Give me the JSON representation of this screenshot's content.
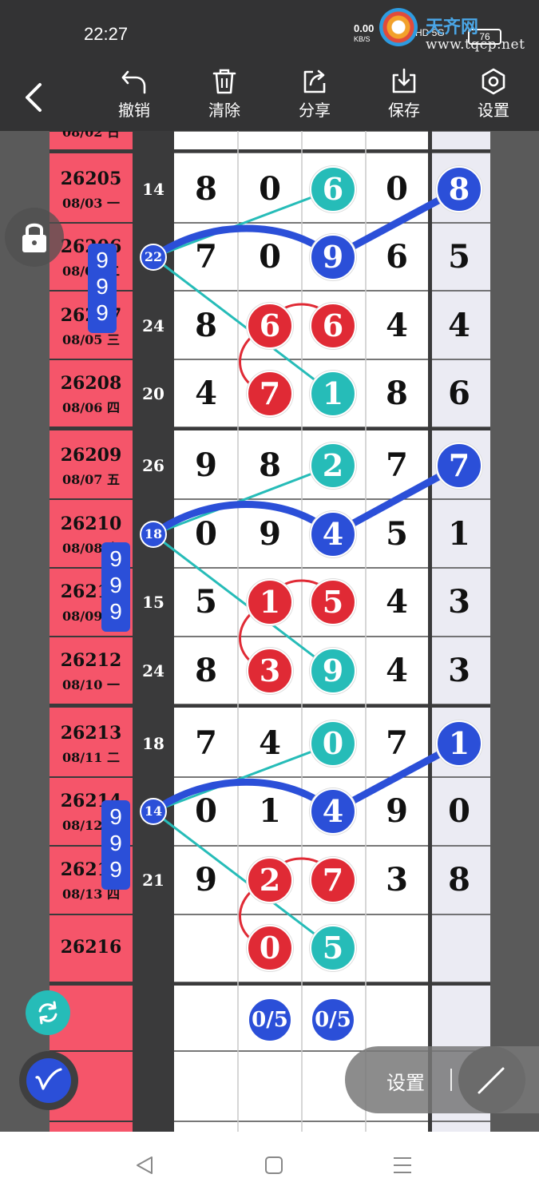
{
  "status_bar": {
    "time": "22:27",
    "net_speed_value": "0.00",
    "net_speed_unit": "KB/S",
    "signal_text": "HD 5G",
    "battery": "76"
  },
  "watermark": {
    "site": "www.tqcp.net",
    "brand": "天齐网"
  },
  "toolbar": {
    "back_icon": "chevron-left-icon",
    "items": [
      {
        "label": "撤销",
        "icon": "undo-icon"
      },
      {
        "label": "清除",
        "icon": "trash-icon"
      },
      {
        "label": "分享",
        "icon": "share-icon"
      },
      {
        "label": "保存",
        "icon": "download-icon"
      },
      {
        "label": "设置",
        "icon": "settings-hex-icon"
      }
    ]
  },
  "periods": [
    {
      "id": "26205",
      "date": "08/03 一",
      "sum": "14",
      "digits": [
        "8",
        "0",
        "6",
        "0",
        "8"
      ]
    },
    {
      "id": "26206",
      "date": "08/04 二",
      "sum": "22",
      "digits": [
        "7",
        "0",
        "9",
        "6",
        "5"
      ]
    },
    {
      "id": "26207",
      "date": "08/05 三",
      "sum": "24",
      "digits": [
        "8",
        "6",
        "6",
        "4",
        "4"
      ]
    },
    {
      "id": "26208",
      "date": "08/06 四",
      "sum": "20",
      "digits": [
        "4",
        "7",
        "1",
        "8",
        "6"
      ]
    },
    {
      "id": "26209",
      "date": "08/07 五",
      "sum": "26",
      "digits": [
        "9",
        "8",
        "2",
        "7",
        "7"
      ]
    },
    {
      "id": "26210",
      "date": "08/08 六",
      "sum": "18",
      "digits": [
        "0",
        "9",
        "4",
        "5",
        "1"
      ]
    },
    {
      "id": "26211",
      "date": "08/09 日",
      "sum": "15",
      "digits": [
        "5",
        "1",
        "5",
        "4",
        "3"
      ]
    },
    {
      "id": "26212",
      "date": "08/10 一",
      "sum": "24",
      "digits": [
        "8",
        "3",
        "9",
        "4",
        "3"
      ]
    },
    {
      "id": "26213",
      "date": "08/11 二",
      "sum": "18",
      "digits": [
        "7",
        "4",
        "0",
        "7",
        "1"
      ]
    },
    {
      "id": "26214",
      "date": "08/12 三",
      "sum": "14",
      "digits": [
        "0",
        "1",
        "4",
        "9",
        "0"
      ]
    },
    {
      "id": "26215",
      "date": "08/13 四",
      "sum": "21",
      "digits": [
        "9",
        "2",
        "7",
        "3",
        "8"
      ]
    },
    {
      "id": "26216",
      "date": "",
      "sum": "",
      "digits": [
        "",
        "0",
        "5",
        "",
        ""
      ]
    }
  ],
  "cut_top_date": "08/02 日",
  "tag_999": "999",
  "ratio_labels": [
    "0/5",
    "0/5"
  ],
  "floating": {
    "lock_icon": "lock-icon",
    "refresh_icon": "refresh-icon",
    "pen_icon": "pen-icon",
    "settings_pill_label": "设置",
    "line_tool_icon": "line-tool-icon"
  },
  "nav": {
    "back": "triangle-back-icon",
    "home": "square-home-icon",
    "menu": "menu-lines-icon"
  },
  "colors": {
    "red": "#e02a35",
    "teal": "#26bcb8",
    "blue": "#2b4fd8",
    "period_bg": "#f5556a"
  }
}
